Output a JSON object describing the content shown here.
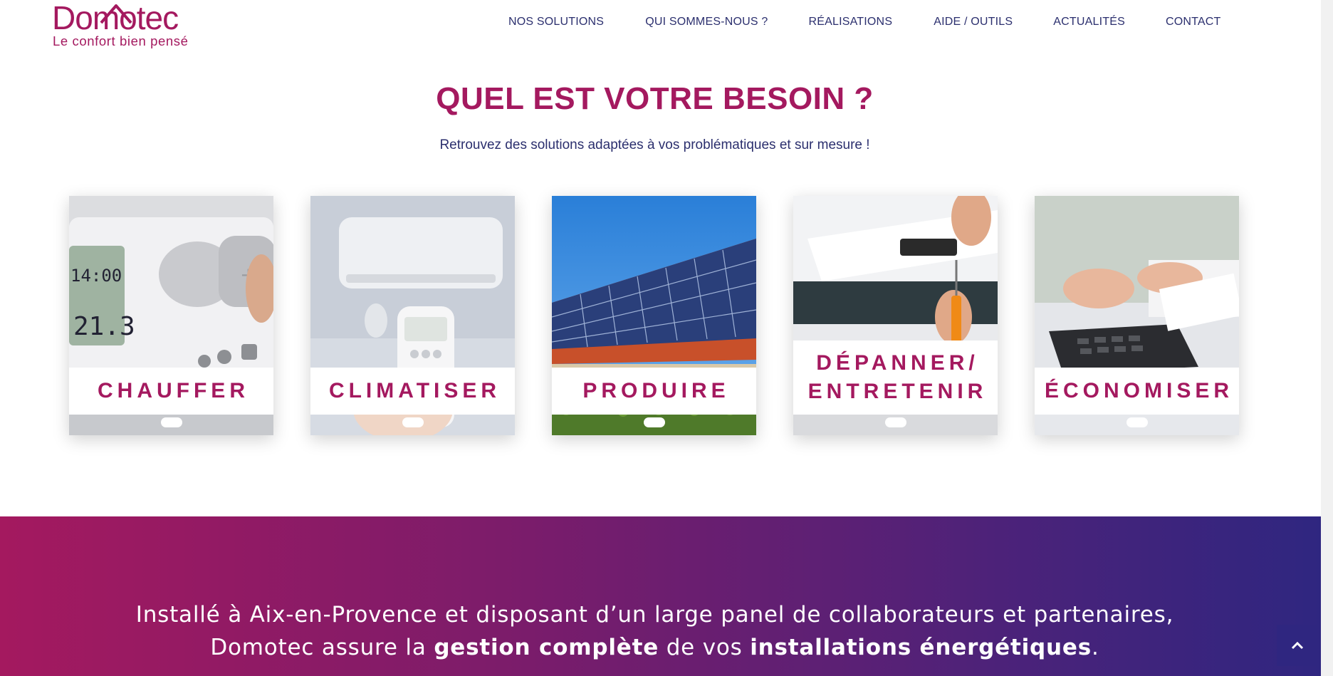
{
  "brand": {
    "name": "Domotec",
    "tagline": "Le confort bien pensé",
    "color": "#a4195f"
  },
  "nav": {
    "items": [
      {
        "label": "NOS SOLUTIONS"
      },
      {
        "label": "QUI SOMMES-NOUS ?"
      },
      {
        "label": "RÉALISATIONS"
      },
      {
        "label": "AIDE / OUTILS"
      },
      {
        "label": "ACTUALITÉS"
      },
      {
        "label": "CONTACT"
      }
    ],
    "color": "#2b2f6e"
  },
  "section": {
    "title": "QUEL EST VOTRE BESOIN ?",
    "subtitle": "Retrouvez des solutions adaptées à vos problématiques et sur mesure !"
  },
  "cards": [
    {
      "label": "CHAUFFER",
      "image": "thermostat-image"
    },
    {
      "label": "CLIMATISER",
      "image": "air-conditioner-image"
    },
    {
      "label": "PRODUIRE",
      "image": "solar-panels-image"
    },
    {
      "label_line1": "DÉPANNER/",
      "label_line2": "ENTRETENIR",
      "image": "repair-image"
    },
    {
      "label": "ÉCONOMISER",
      "image": "calculator-image"
    }
  ],
  "banner": {
    "line1": "Installé à Aix-en-Provence et disposant d’un large panel de collaborateurs et partenaires,",
    "line2_pre": "Domotec assure la ",
    "line2_bold1": "gestion complète",
    "line2_mid": " de vos ",
    "line2_bold2": "installations énergétiques",
    "line2_post": ".",
    "gradient_start": "#a4195f",
    "gradient_end": "#2f2680"
  },
  "scroll_top": {
    "icon": "chevron-up-icon"
  }
}
